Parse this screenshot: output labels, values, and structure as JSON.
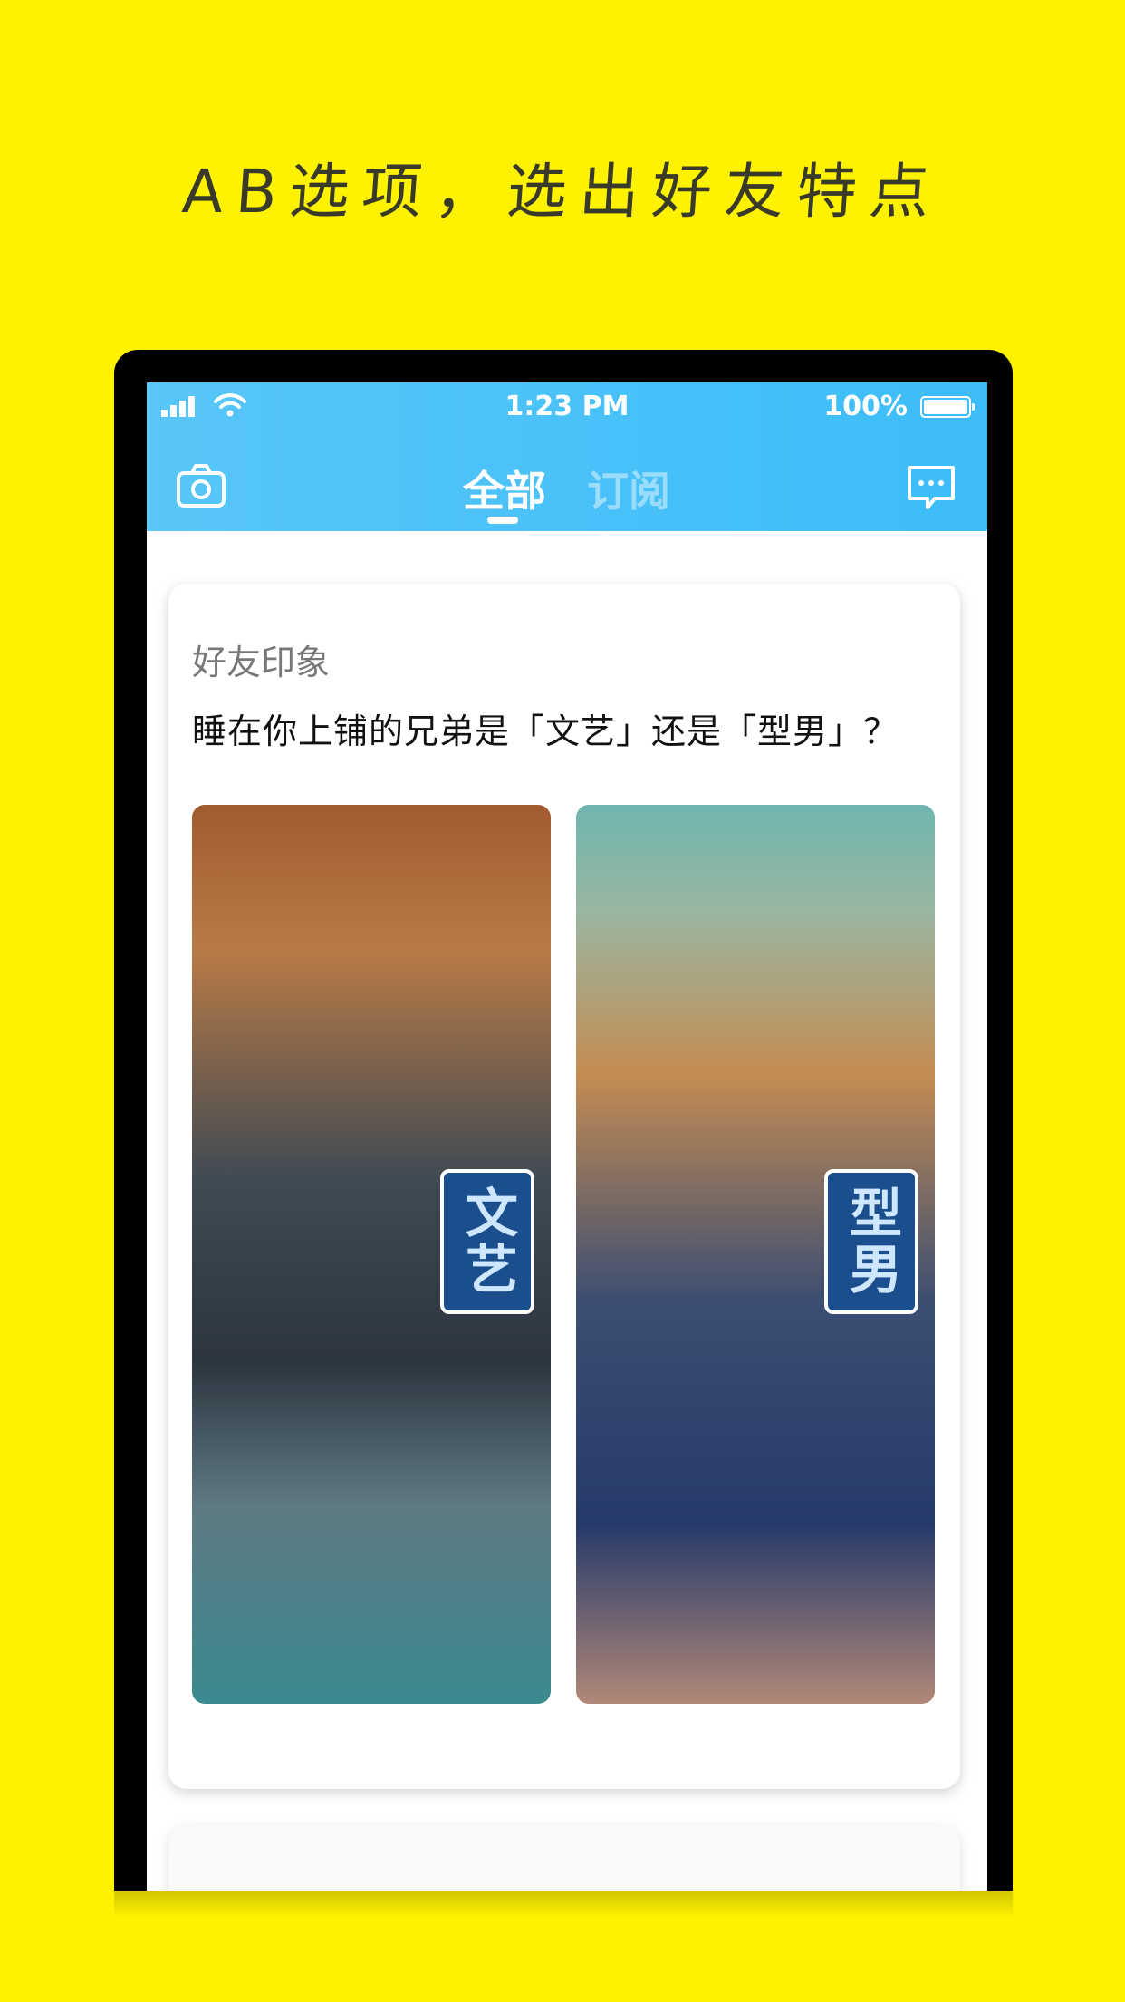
{
  "headline": "AB选项，选出好友特点",
  "status_bar": {
    "time": "1:23 PM",
    "battery": "100%"
  },
  "nav": {
    "tab_all": "全部",
    "tab_subscribe": "订阅"
  },
  "card": {
    "category": "好友印象",
    "question": "睡在你上铺的兄弟是「文艺」还是「型男」？",
    "option_a": {
      "tag": "文艺"
    },
    "option_b": {
      "tag": "型男"
    }
  },
  "colors": {
    "background": "#FFF200",
    "header": "#4cc3f8",
    "tag": "#1a4e8c"
  }
}
